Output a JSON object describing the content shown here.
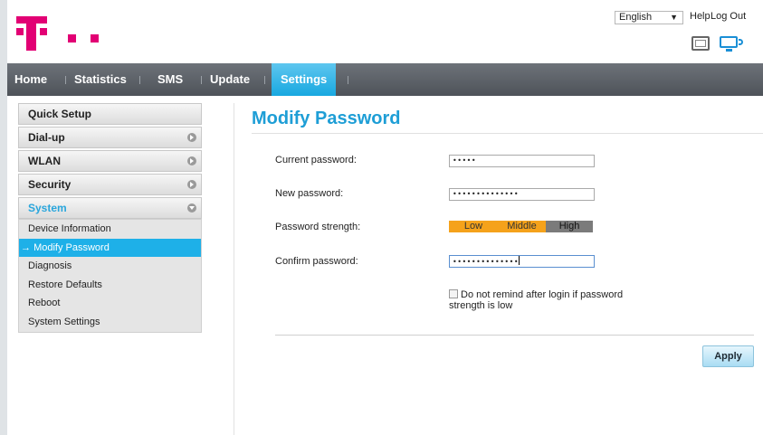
{
  "brand": {
    "color": "#e20074",
    "accent": "#1eb0e8",
    "logo_name": "telekom-t-logo"
  },
  "topbar": {
    "language": "English",
    "help": "Help",
    "logout": "Log Out",
    "icons": [
      "window-icon",
      "monitor-wifi-icon"
    ]
  },
  "nav": {
    "items": [
      {
        "label": "Home"
      },
      {
        "label": "Statistics"
      },
      {
        "label": "SMS"
      },
      {
        "label": "Update"
      },
      {
        "label": "Settings",
        "active": true
      }
    ]
  },
  "sidebar": {
    "groups": [
      {
        "label": "Quick Setup"
      },
      {
        "label": "Dial-up"
      },
      {
        "label": "WLAN"
      },
      {
        "label": "Security"
      },
      {
        "label": "System",
        "open": true
      }
    ],
    "system_items": [
      {
        "label": "Device Information"
      },
      {
        "label": "Modify Password",
        "active": true
      },
      {
        "label": "Diagnosis"
      },
      {
        "label": "Restore Defaults"
      },
      {
        "label": "Reboot"
      },
      {
        "label": "System Settings"
      }
    ],
    "active_marker": "→"
  },
  "main": {
    "title": "Modify Password",
    "current_password_label": "Current password:",
    "current_password_value": "•••••",
    "new_password_label": "New password:",
    "new_password_value": "••••••••••••••",
    "strength_label": "Password strength:",
    "strength_levels": [
      "Low",
      "Middle",
      "High"
    ],
    "confirm_password_label": "Confirm password:",
    "confirm_password_value": "••••••••••••••",
    "remind_checkbox_label": "Do not remind after login if password strength is low",
    "remind_checked": false,
    "apply_label": "Apply"
  }
}
